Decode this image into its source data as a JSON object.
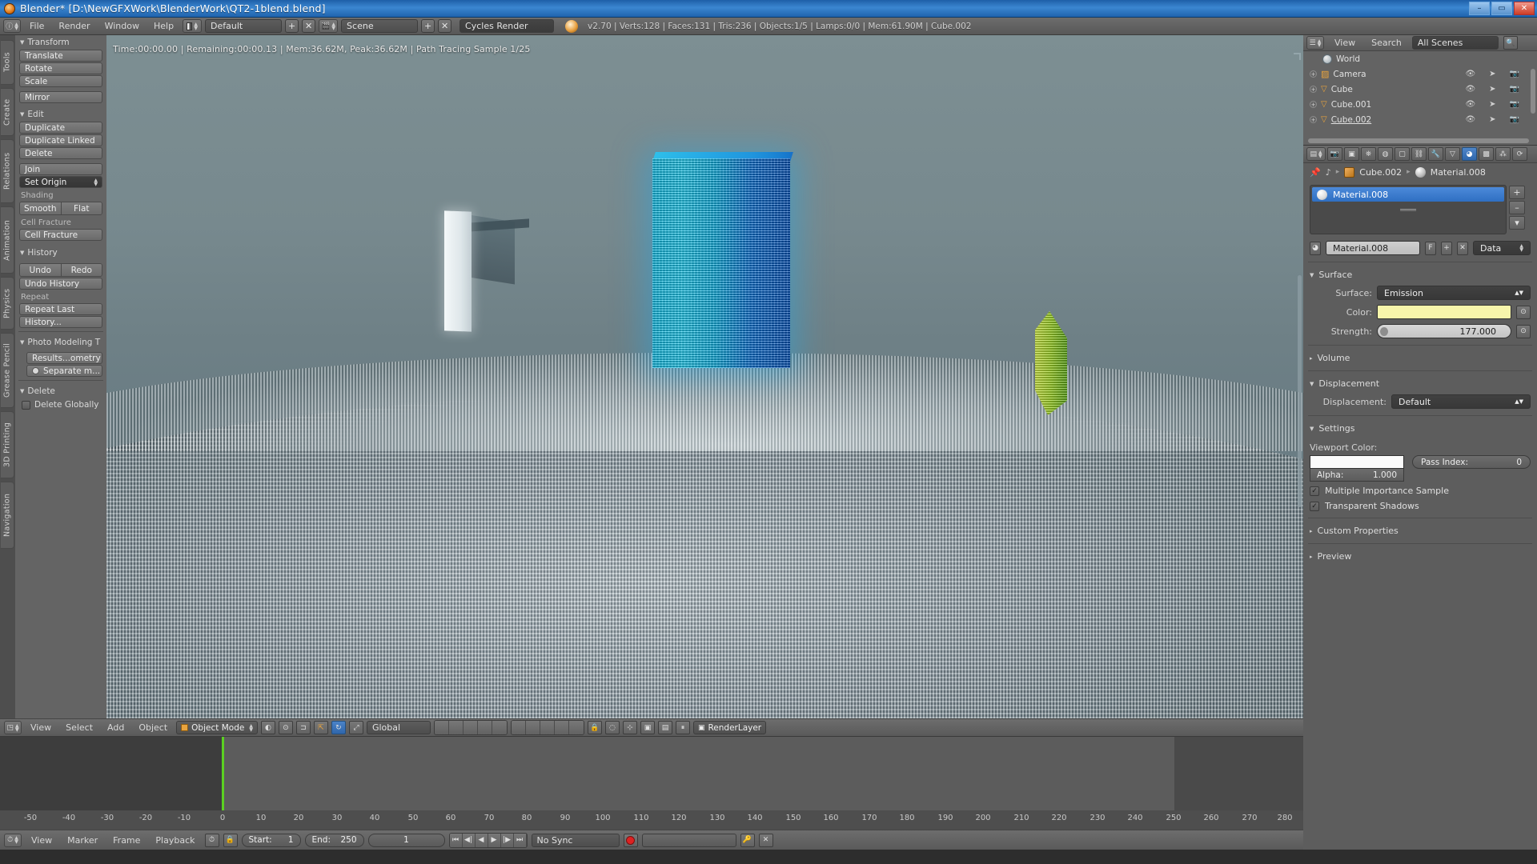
{
  "window": {
    "title": "Blender* [D:\\NewGFXWork\\BlenderWork\\QT2-1blend.blend]",
    "icon": "blender-logo-icon",
    "minimize": "–",
    "maximize": "▭",
    "close": "✕"
  },
  "topbar": {
    "editor_icon": "info-editor-icon",
    "menus": [
      "File",
      "Render",
      "Window",
      "Help"
    ],
    "screen_layout": "Default",
    "screen_add": "+",
    "screen_delete": "✕",
    "scene_name": "Scene",
    "scene_add": "+",
    "scene_delete": "✕",
    "engine": "Cycles Render",
    "version_info": "v2.70 | Verts:128 | Faces:131 | Tris:236 | Objects:1/5 | Lamps:0/0 | Mem:61.90M | Cube.002"
  },
  "toolshelf": {
    "tabs": [
      "Tools",
      "Create",
      "Relations",
      "Animation",
      "Physics",
      "Grease Pencil",
      "3D Printing",
      "Navigation"
    ],
    "sections": [
      {
        "title": "Transform",
        "buttons": [
          "Translate",
          "Rotate",
          "Scale",
          "Mirror"
        ]
      },
      {
        "title": "Edit",
        "buttons": [
          "Duplicate",
          "Duplicate Linked",
          "Delete",
          "Join"
        ],
        "dropdown": "Set Origin",
        "sublabel_shading": "Shading",
        "shading_buttons": [
          "Smooth",
          "Flat"
        ],
        "sublabel_cell": "Cell Fracture",
        "cell_button": "Cell Fracture"
      },
      {
        "title": "History",
        "undo": "Undo",
        "redo": "Redo",
        "undo_history": "Undo History",
        "sublabel_repeat": "Repeat",
        "repeat_last": "Repeat Last",
        "history": "History..."
      },
      {
        "title": "Photo Modeling T",
        "buttons": [
          "Results...ometry",
          "Separate m..."
        ]
      },
      {
        "title": "Delete",
        "checkbox": "Delete Globally"
      }
    ]
  },
  "viewport": {
    "render_status": "Time:00:00.00 | Remaining:00:00.13 | Mem:36.62M, Peak:36.62M | Path Tracing Sample 1/25",
    "header": {
      "editor_icon": "3d-view-editor-icon",
      "menus": [
        "View",
        "Select",
        "Add",
        "Object"
      ],
      "mode": "Object Mode",
      "viewport_shading": "shading-icon",
      "pivot": "pivot-icon",
      "snap": "magnet-icon",
      "manipulator_move": "move-manipulator-icon",
      "manipulator_rotate": "rotate-manipulator-icon",
      "orientation": "Global",
      "layers": "layer-grid",
      "render_layer": "RenderLayer"
    },
    "colors": {
      "sky": "#6a7d84",
      "blue_emissive": "#17c6f0",
      "green_emissive": "#9ed22c"
    }
  },
  "timeline": {
    "ruler_ticks": [
      "-50",
      "-40",
      "-30",
      "-20",
      "-10",
      "0",
      "10",
      "20",
      "30",
      "40",
      "50",
      "60",
      "70",
      "80",
      "90",
      "100",
      "110",
      "120",
      "130",
      "140",
      "150",
      "160",
      "170",
      "180",
      "190",
      "200",
      "210",
      "220",
      "230",
      "240",
      "250",
      "260",
      "270",
      "280"
    ],
    "playhead_frame": "0",
    "header": {
      "editor_icon": "timeline-editor-icon",
      "menus": [
        "View",
        "Marker",
        "Frame",
        "Playback"
      ],
      "start_label": "Start:",
      "start_value": "1",
      "end_label": "End:",
      "end_value": "250",
      "current_frame": "1",
      "sync_mode": "No Sync",
      "record_icon": "record-icon"
    }
  },
  "outliner": {
    "editor_icon": "outliner-editor-icon",
    "menus": [
      "View",
      "Search"
    ],
    "display_mode": "All Scenes",
    "search_icon": "search-icon",
    "rows": [
      {
        "name": "World",
        "icon": "world-icon",
        "expandable": false
      },
      {
        "name": "Camera",
        "icon": "camera-data-icon",
        "expandable": true
      },
      {
        "name": "Cube",
        "icon": "mesh-icon",
        "expandable": true
      },
      {
        "name": "Cube.001",
        "icon": "mesh-icon",
        "expandable": true
      },
      {
        "name": "Cube.002",
        "icon": "mesh-icon",
        "expandable": true
      }
    ],
    "row_icons": [
      "eye-icon",
      "cursor-arrow-icon",
      "camera-icon"
    ]
  },
  "properties": {
    "tabs": [
      "render-tab",
      "render-layers-tab",
      "scene-tab",
      "world-tab",
      "object-tab",
      "constraints-tab",
      "modifiers-tab",
      "data-tab",
      "material-tab",
      "texture-tab",
      "particles-tab",
      "physics-tab"
    ],
    "active_tab_index": 8,
    "breadcrumb": {
      "pin_icon": "pin-icon",
      "browse_icon": "browse-material-icon",
      "object_name": "Cube.002",
      "material_name": "Material.008"
    },
    "material_slot": "Material.008",
    "slot_buttons": [
      "+",
      "–",
      "▾"
    ],
    "datablock": {
      "name": "Material.008",
      "fake_user": "F",
      "add": "+",
      "unlink": "✕",
      "type": "Data"
    },
    "surface": {
      "title": "Surface",
      "surface_label": "Surface:",
      "surface_value": "Emission",
      "color_label": "Color:",
      "color_value": "#f7f5ab",
      "strength_label": "Strength:",
      "strength_value": "177.000"
    },
    "volume": {
      "title": "Volume"
    },
    "displacement": {
      "title": "Displacement",
      "label": "Displacement:",
      "value": "Default"
    },
    "settings": {
      "title": "Settings",
      "viewport_color_label": "Viewport Color:",
      "viewport_color_value": "#fbfbfb",
      "alpha_label": "Alpha:",
      "alpha_value": "1.000",
      "pass_index_label": "Pass Index:",
      "pass_index_value": "0",
      "multiple_importance_sample": "Multiple Importance Sample",
      "transparent_shadows": "Transparent Shadows",
      "check_glyph": "✓"
    },
    "custom_properties": {
      "title": "Custom Properties"
    },
    "preview": {
      "title": "Preview"
    }
  }
}
